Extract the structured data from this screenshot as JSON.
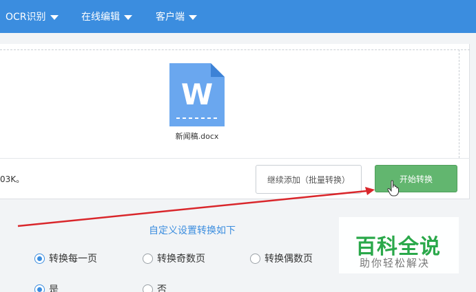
{
  "navbar": {
    "items": [
      {
        "label": "OCR识别"
      },
      {
        "label": "在线编辑"
      },
      {
        "label": "客户端"
      }
    ]
  },
  "upload": {
    "file_name": "新闻稿.docx",
    "file_icon_letter": "W",
    "size_note": "03K。"
  },
  "actions": {
    "add_label": "继续添加（批量转换）",
    "start_label": "开始转换"
  },
  "settings": {
    "title": "自定义设置转换如下",
    "page_options": [
      {
        "label": "转换每一页",
        "checked": true
      },
      {
        "label": "转换奇数页",
        "checked": false
      },
      {
        "label": "转换偶数页",
        "checked": false
      }
    ],
    "yes_no_options": [
      {
        "label": "是",
        "checked": true
      },
      {
        "label": "否",
        "checked": false
      }
    ]
  },
  "watermark": {
    "main": "百科全说",
    "sub": "助你轻松解决"
  },
  "colors": {
    "nav_blue": "#3b8ddf",
    "start_green": "#62b66f",
    "arrow_red": "#d9262b",
    "watermark_green": "#2aa84a"
  },
  "icons": {
    "file": "word-file-icon",
    "cursor": "hand-cursor-icon",
    "caret": "caret-down-icon"
  }
}
